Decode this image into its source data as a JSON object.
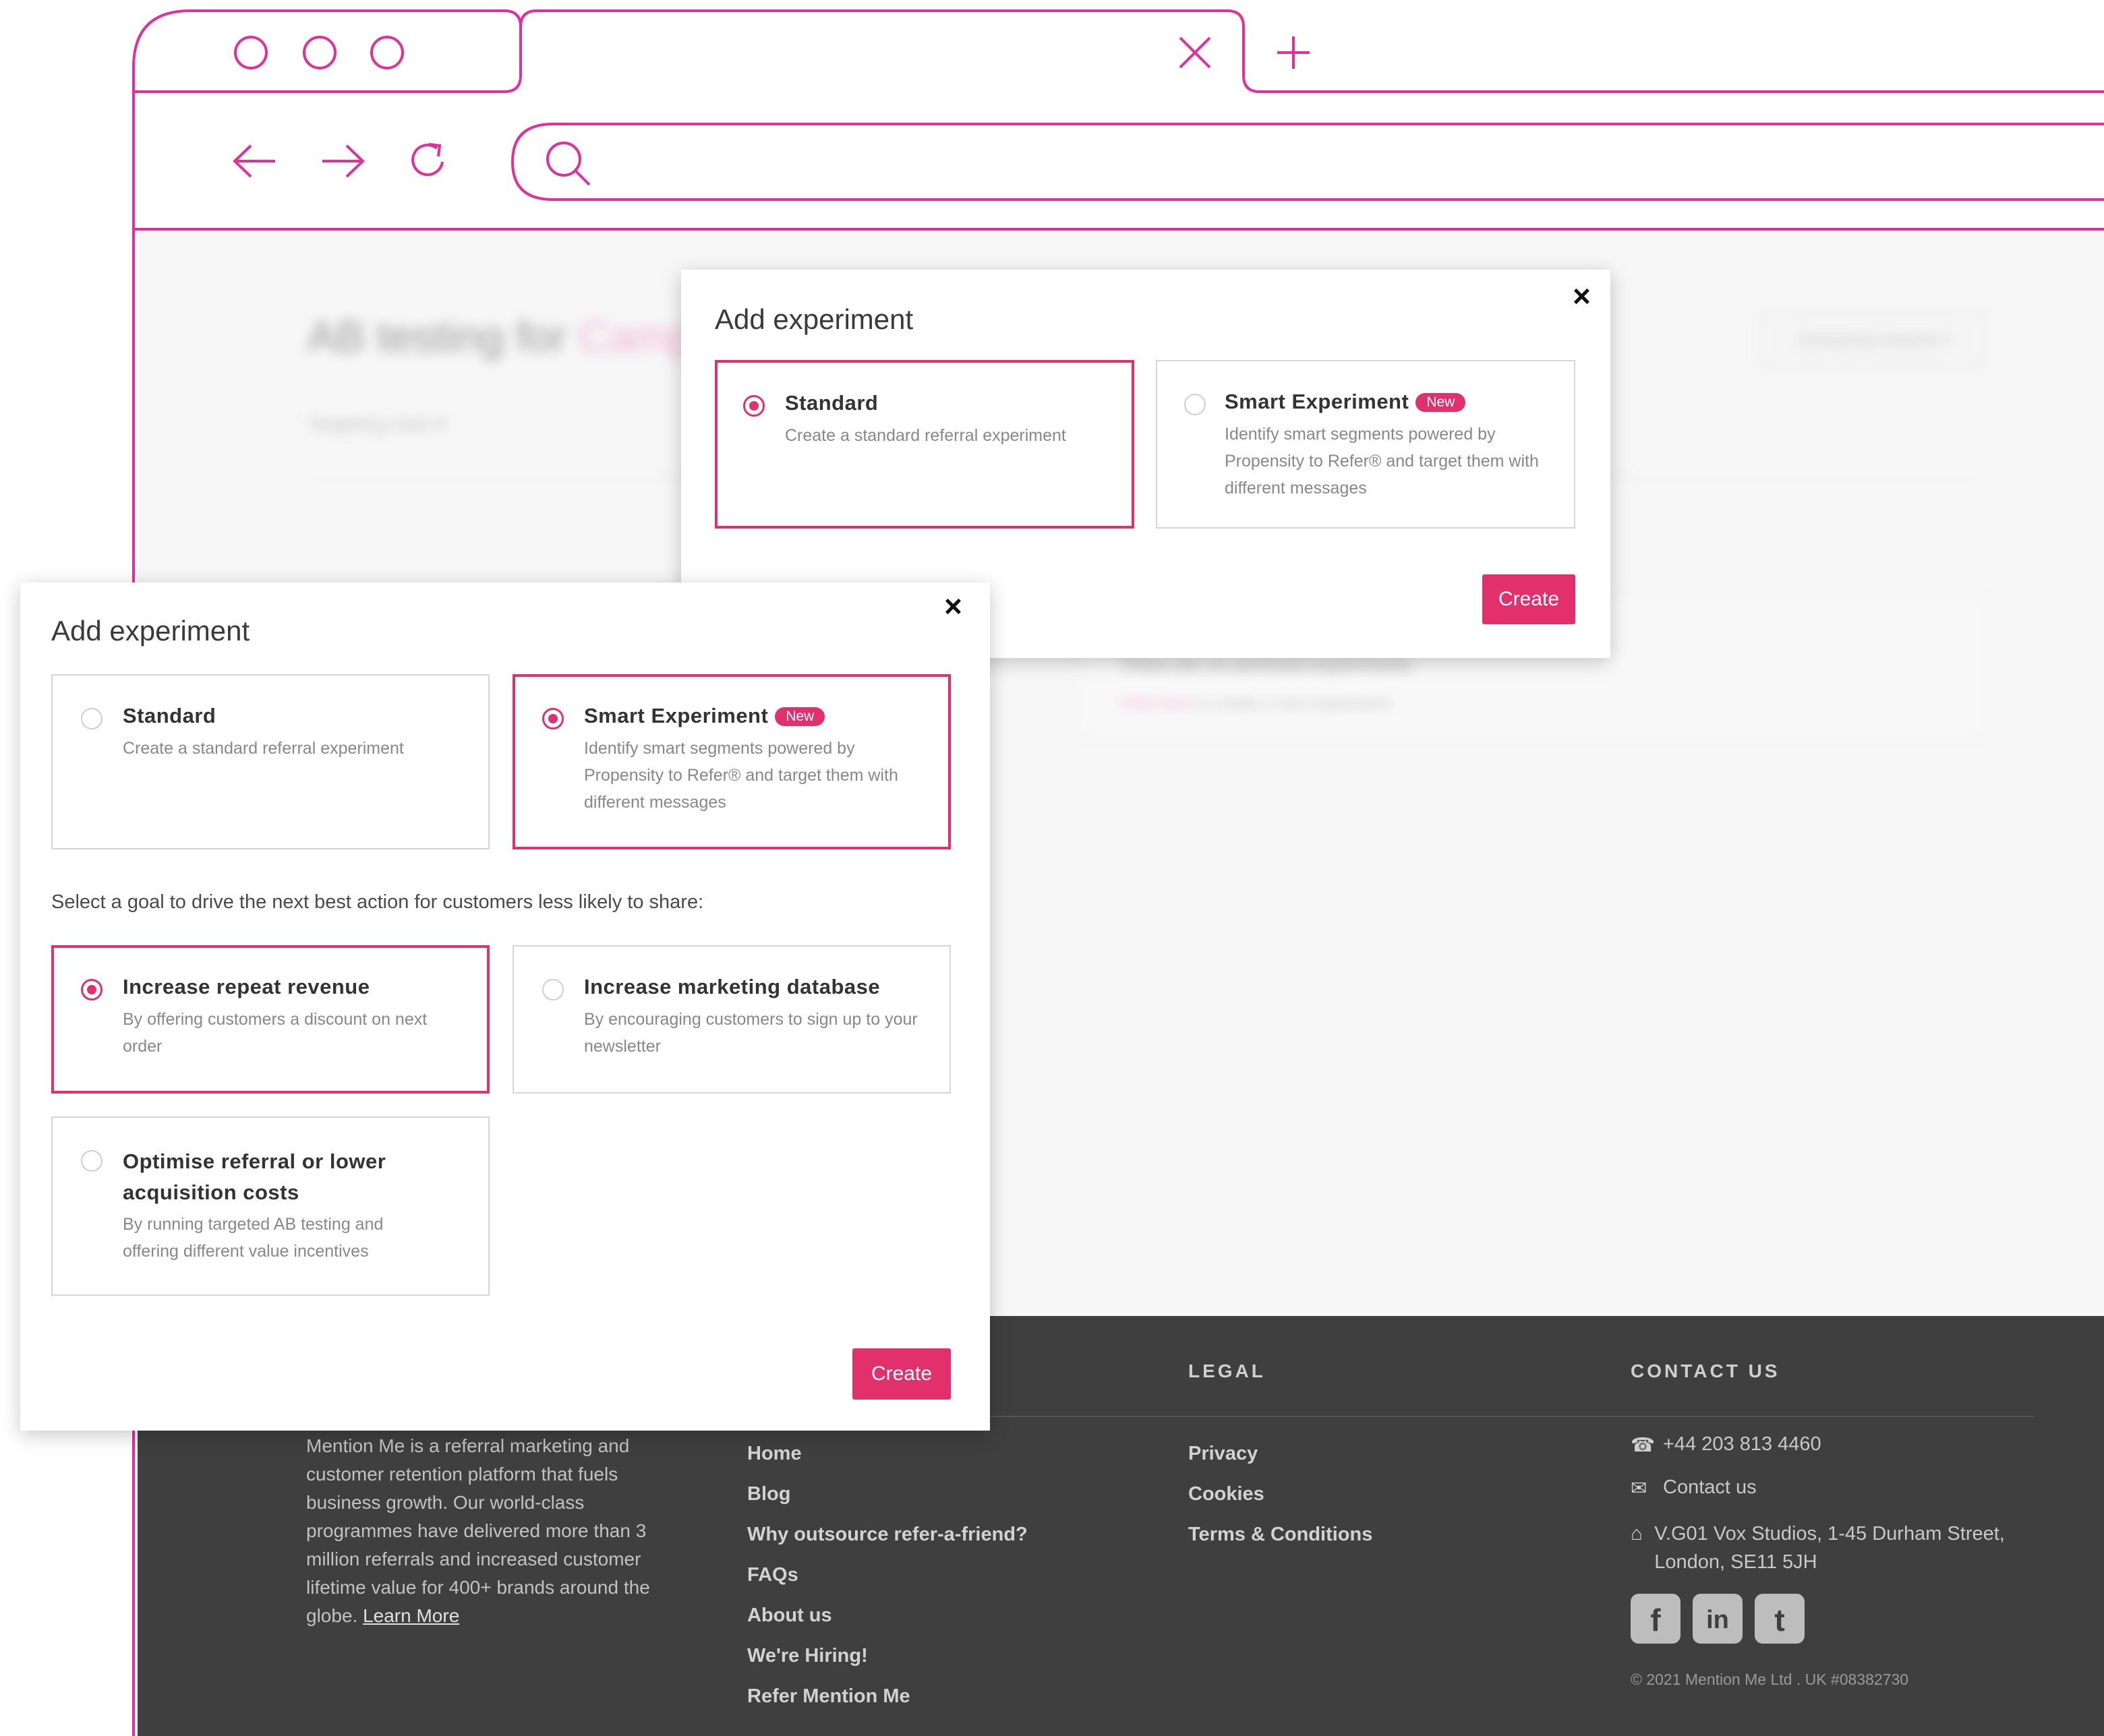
{
  "colors": {
    "accent": "#e1306c",
    "chrome_outline": "#e1309a",
    "footer_bg": "#3f3f3f"
  },
  "browser": {
    "window_controls": [
      "circle",
      "circle",
      "circle"
    ],
    "tab_close_icon": "close-icon",
    "new_tab_icon": "plus-icon",
    "nav_icons": [
      "back-arrow-icon",
      "forward-arrow-icon",
      "reload-icon",
      "search-icon"
    ]
  },
  "background_page": {
    "title_prefix": "AB testing for",
    "title_highlight": "Campaign",
    "subtitle": "Targeting rules ▾",
    "dropdown": "Comparing variants ▾",
    "empty_title": "There are no archived experiments",
    "empty_link": "Click here",
    "empty_rest": "to create a new experiment"
  },
  "modal_back": {
    "title": "Add experiment",
    "options": [
      {
        "title": "Standard",
        "desc": "Create a standard referral experiment",
        "selected": true
      },
      {
        "title": "Smart Experiment",
        "badge": "New",
        "desc": "Identify smart segments powered by Propensity to Refer® and target them with different messages",
        "selected": false
      }
    ],
    "create": "Create"
  },
  "modal_front": {
    "title": "Add experiment",
    "options": [
      {
        "title": "Standard",
        "desc": "Create a standard referral experiment",
        "selected": false
      },
      {
        "title": "Smart Experiment",
        "badge": "New",
        "desc": "Identify smart segments powered by Propensity to Refer® and target them with different messages",
        "selected": true
      }
    ],
    "goal_prompt": "Select a goal to drive the next best action for customers less likely to share:",
    "goals": [
      {
        "title": "Increase repeat revenue",
        "desc": "By offering customers a discount on next order",
        "selected": true
      },
      {
        "title": "Increase marketing database",
        "desc": "By encouraging customers to sign up to your newsletter",
        "selected": false
      },
      {
        "title": "Optimise referral or lower acquisition costs",
        "desc": "By running targeted AB testing and offering different value incentives",
        "selected": false
      }
    ],
    "create": "Create"
  },
  "footer": {
    "about": "Mention Me is a referral marketing and customer retention platform that fuels business growth. Our world-class programmes have delivered more than 3 million referrals and increased customer lifetime value for 400+ brands around the globe.",
    "learn_more": "Learn More",
    "links": [
      "Home",
      "Blog",
      "Why outsource refer-a-friend?",
      "FAQs",
      "About us",
      "We're Hiring!",
      "Refer Mention Me"
    ],
    "legal_heading": "LEGAL",
    "legal": [
      "Privacy",
      "Cookies",
      "Terms & Conditions"
    ],
    "contact_heading": "CONTACT US",
    "phone": "+44 203 813 4460",
    "contact_link": "Contact us",
    "address": "V.G01 Vox Studios, 1-45 Durham Street, London, SE11 5JH",
    "social": [
      "facebook-icon",
      "linkedin-icon",
      "twitter-icon"
    ],
    "copyright": "© 2021 Mention Me Ltd . UK #08382730"
  }
}
